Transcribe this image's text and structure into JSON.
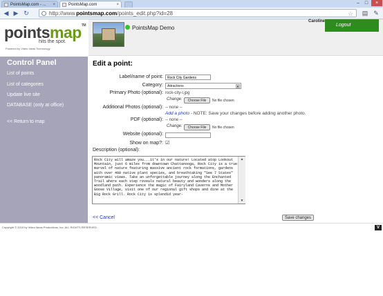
{
  "browser": {
    "tabs": [
      {
        "label": "PointsMap.com - ..."
      },
      {
        "label": "PointsMap.com"
      }
    ],
    "url_prefix": "http://www.",
    "url_host": "pointsmap.com",
    "url_path": "/points_edit.php?id=28"
  },
  "header": {
    "logo_part1": "points",
    "logo_part2": "map",
    "logo_tm": "TM",
    "tagline": "hits the spot.",
    "powered": "Powered by Video Ideas Technology",
    "site_name": "PointsMap Demo",
    "user_name": "Caroline",
    "logout_label": "Logout"
  },
  "sidebar": {
    "title": "Control Panel",
    "items": [
      {
        "label": "List of points"
      },
      {
        "label": "List of categories"
      },
      {
        "label": "Update live site"
      },
      {
        "label": "DATABASE (only at office)"
      },
      {
        "label": "<< Return to map"
      }
    ]
  },
  "form": {
    "title": "Edit a point:",
    "name_label": "Label/name of point:",
    "name_value": "Rock City Gardens",
    "category_label": "Category:",
    "category_value": "Attractions",
    "primary_label": "Primary Photo (optional):",
    "primary_file": "rock-city-l.jpg",
    "change_label": "Change:",
    "choose_file_label": "Choose File",
    "no_file_label": "No file chosen",
    "additional_label": "Additional Photos (optional):",
    "none_label": "-- none --",
    "add_photo_label": "Add a photo",
    "add_photo_note": " - NOTE: Save your changes before adding another photo.",
    "pdf_label": "PDF (optional):",
    "website_label": "Website (optional):",
    "website_value": "",
    "show_label": "Show on map?:",
    "show_checked": true,
    "desc_label": "Description (optional):",
    "desc_value": "Rock City will amaze you...it's in our nature! Located atop Lookout Mountain, just 6 miles from downtown Chattanooga, Rock City is a true marvel of nature featuring massive ancient rock formations, gardens with over 400 native plant species, and breathtaking \"See 7 States\" panoramic views. Take an unforgettable journey along the Enchanted Trail where each step reveals natural beauty and wonders along the woodland path. Experience the magic of Fairyland Caverns and Mother Goose Village, visit one of our regional gift shops and dine at the Big Rock Grill. Rock City is splendid year-",
    "cancel_label": "<< Cancel",
    "save_label": "Save changes"
  },
  "footer": {
    "copyright": "Copyright © 2010 by Video Ideas Productions, Inc. ALL RIGHTS RESERVED.",
    "logo_letter": "V"
  }
}
